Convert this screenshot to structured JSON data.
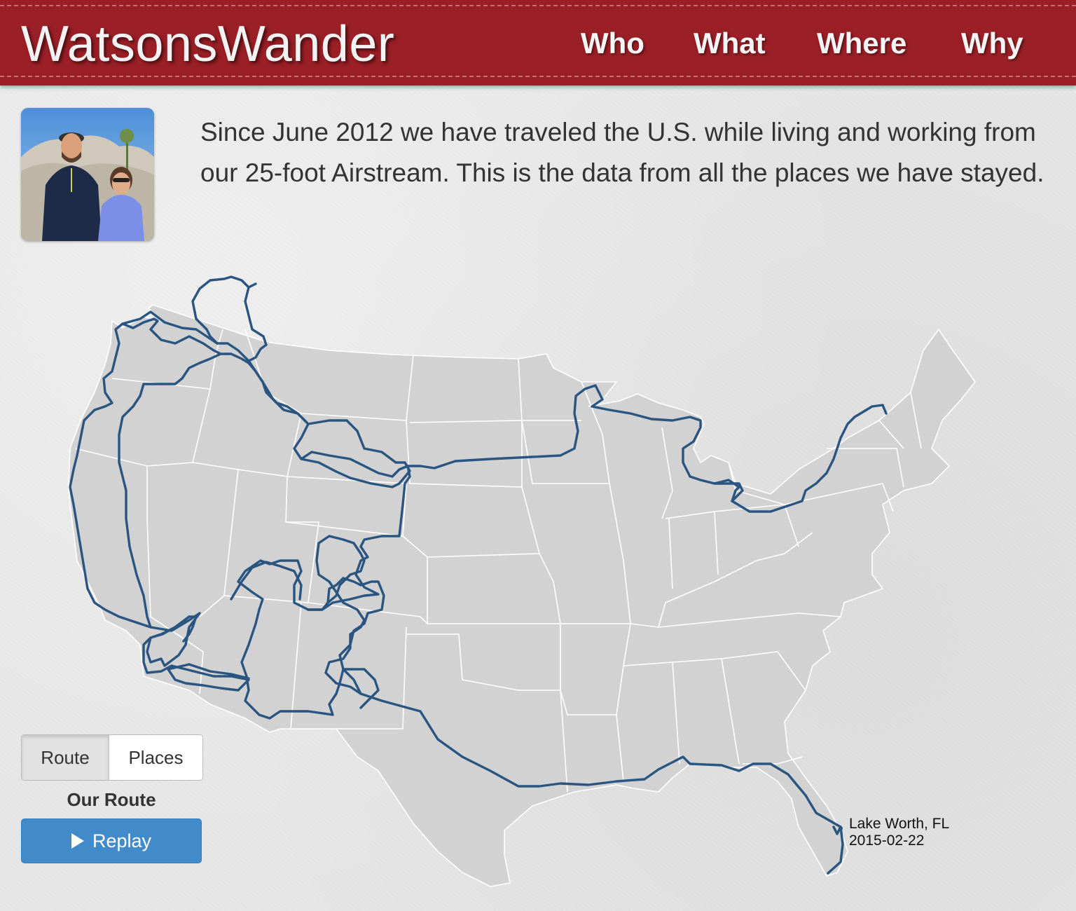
{
  "header": {
    "brand": "WatsonsWander",
    "nav": [
      {
        "label": "Who"
      },
      {
        "label": "What"
      },
      {
        "label": "Where"
      },
      {
        "label": "Why"
      }
    ]
  },
  "intro": {
    "text": "Since June 2012 we have traveled the U.S. while living and working from our 25-foot Airstream. This is the data from all the places we have stayed."
  },
  "map": {
    "last_stop": {
      "place": "Lake Worth, FL",
      "date": "2015-02-22"
    },
    "route_color": "#2a5580",
    "land_color": "#d2d2d2"
  },
  "controls": {
    "tabs": [
      {
        "label": "Route",
        "active": true
      },
      {
        "label": "Places",
        "active": false
      }
    ],
    "caption": "Our Route",
    "replay_label": "Replay"
  },
  "colors": {
    "header_bg": "#9a1f26",
    "replay_bg": "#428bca"
  }
}
